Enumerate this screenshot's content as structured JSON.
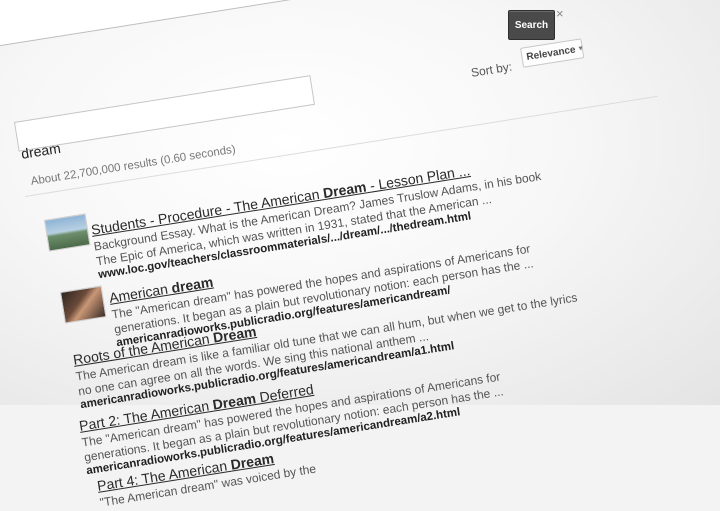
{
  "search_bar": {
    "value": "",
    "button_label": "Search",
    "close_glyph": "×"
  },
  "sort": {
    "label": "Sort by:",
    "selected": "Relevance"
  },
  "query": {
    "value": "dream"
  },
  "stats": "About 22,700,000 results (0.60 seconds)",
  "results": [
    {
      "title_pre": "Students - Procedure - The American ",
      "title_bold": "Dream",
      "title_post": " - Lesson Plan ...",
      "snippet1": "Background Essay. What is the American Dream? James Truslow Adams, in his book",
      "snippet2": "The Epic of America, which was written in 1931, stated that the American ...",
      "url": "www.loc.gov/teachers/classroommaterials/.../dream/.../thedream.html"
    },
    {
      "title_pre": "American ",
      "title_bold": "dream",
      "title_post": "",
      "snippet1": "The \"American dream\" has powered the hopes and aspirations of Americans for",
      "snippet2": "generations. It began as a plain but revolutionary notion: each person has the ...",
      "url": "americanradioworks.publicradio.org/features/americandream/"
    },
    {
      "title_pre": "Roots of the American ",
      "title_bold": "Dream",
      "title_post": "",
      "snippet1": "The American dream is like a familiar old tune that we can all hum, but when we get to the lyrics",
      "snippet2": "no one can agree on all the words. We sing this national anthem ...",
      "url": "americanradioworks.publicradio.org/features/americandream/a1.html"
    },
    {
      "title_pre": "Part 2: The American ",
      "title_bold": "Dream",
      "title_post": " Deferred",
      "snippet1": "The \"American dream\" has powered the hopes and aspirations of Americans for",
      "snippet2": "generations. It began as a plain but revolutionary notion: each person has the ...",
      "url": "americanradioworks.publicradio.org/features/americandream/a2.html"
    },
    {
      "title_pre": "Part 4: The American ",
      "title_bold": "Dream",
      "title_post": "",
      "snippet1": "\"The American dream\" was voiced by the",
      "snippet2": "",
      "url": ""
    }
  ]
}
